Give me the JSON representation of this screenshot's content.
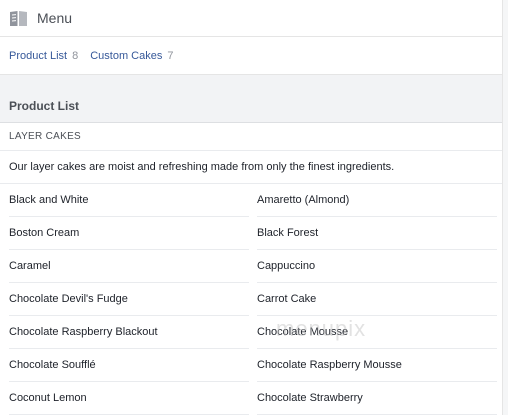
{
  "header": {
    "title": "Menu",
    "icon": "menu-book-icon"
  },
  "tabs": [
    {
      "label": "Product List",
      "count": "8"
    },
    {
      "label": "Custom Cakes",
      "count": "7"
    }
  ],
  "section": {
    "title": "Product List",
    "category": "LAYER CAKES",
    "description": "Our layer cakes are moist and refreshing made from only the finest ingredients."
  },
  "items": [
    "Black and White",
    "Amaretto (Almond)",
    "Boston Cream",
    "Black Forest",
    "Caramel",
    "Cappuccino",
    "Chocolate Devil's Fudge",
    "Carrot Cake",
    "Chocolate Raspberry Blackout",
    "Chocolate Mousse",
    "Chocolate Soufflé",
    "Chocolate Raspberry Mousse",
    "Coconut Lemon",
    "Chocolate Strawberry"
  ],
  "watermark": "menupix",
  "colors": {
    "link": "#365899",
    "muted": "#90949c",
    "section_bg": "#f2f3f5"
  }
}
